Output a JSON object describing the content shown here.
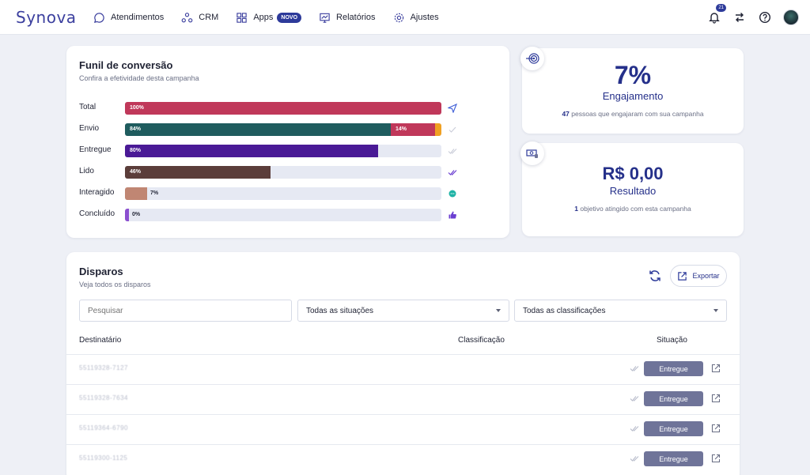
{
  "brand": "Synova",
  "nav": {
    "items": [
      {
        "label": "Atendimentos",
        "icon": "chat-icon"
      },
      {
        "label": "CRM",
        "icon": "crm-icon"
      },
      {
        "label": "Apps",
        "icon": "apps-grid-icon",
        "badge": "NOVO"
      },
      {
        "label": "Relatórios",
        "icon": "report-icon"
      },
      {
        "label": "Ajustes",
        "icon": "gear-icon"
      }
    ],
    "notifications": "21"
  },
  "funnel": {
    "title": "Funil de conversão",
    "subtitle": "Confira a efetividade desta campanha",
    "rows": [
      {
        "label": "Total",
        "value": 100,
        "text": "100%",
        "color": "#c0385a",
        "icon": "send-icon"
      },
      {
        "label": "Envio",
        "value": 84,
        "text": "84%",
        "color": "#1f5c5e",
        "icon": "check-icon",
        "extra": {
          "value": 14,
          "text": "14%",
          "color": "#c0385a"
        },
        "extra2_color": "#f0a023"
      },
      {
        "label": "Entregue",
        "value": 80,
        "text": "80%",
        "color": "#4a1a96",
        "icon": "double-check-icon"
      },
      {
        "label": "Lido",
        "value": 46,
        "text": "46%",
        "color": "#5b3d3a",
        "icon": "read-check-icon"
      },
      {
        "label": "Interagido",
        "value": 7,
        "text": "7%",
        "color": "#c08673",
        "icon": "chat-bubble-icon"
      },
      {
        "label": "Concluído",
        "value": 0,
        "text": "0%",
        "color": "#8b4fcf",
        "icon": "thumbs-up-icon"
      }
    ]
  },
  "metrics": {
    "engagement": {
      "value": "7%",
      "label": "Engajamento",
      "count": "47",
      "desc": "pessoas que engajaram com sua campanha"
    },
    "result": {
      "value": "R$ 0,00",
      "label": "Resultado",
      "count": "1",
      "desc": "objetivo atingido com esta campanha"
    }
  },
  "disparos": {
    "title": "Disparos",
    "subtitle": "Veja todos os disparos",
    "export_label": "Exportar",
    "search_placeholder": "Pesquisar",
    "filter_situation": "Todas as situações",
    "filter_class": "Todas as classificações",
    "columns": [
      "Destinatário",
      "Classificação",
      "Situação"
    ],
    "rows": [
      {
        "phone": "55119328-7127",
        "status": "Entregue"
      },
      {
        "phone": "55119328-7634",
        "status": "Entregue"
      },
      {
        "phone": "55119364-6790",
        "status": "Entregue"
      },
      {
        "phone": "55119300-1125",
        "status": "Entregue"
      }
    ]
  }
}
